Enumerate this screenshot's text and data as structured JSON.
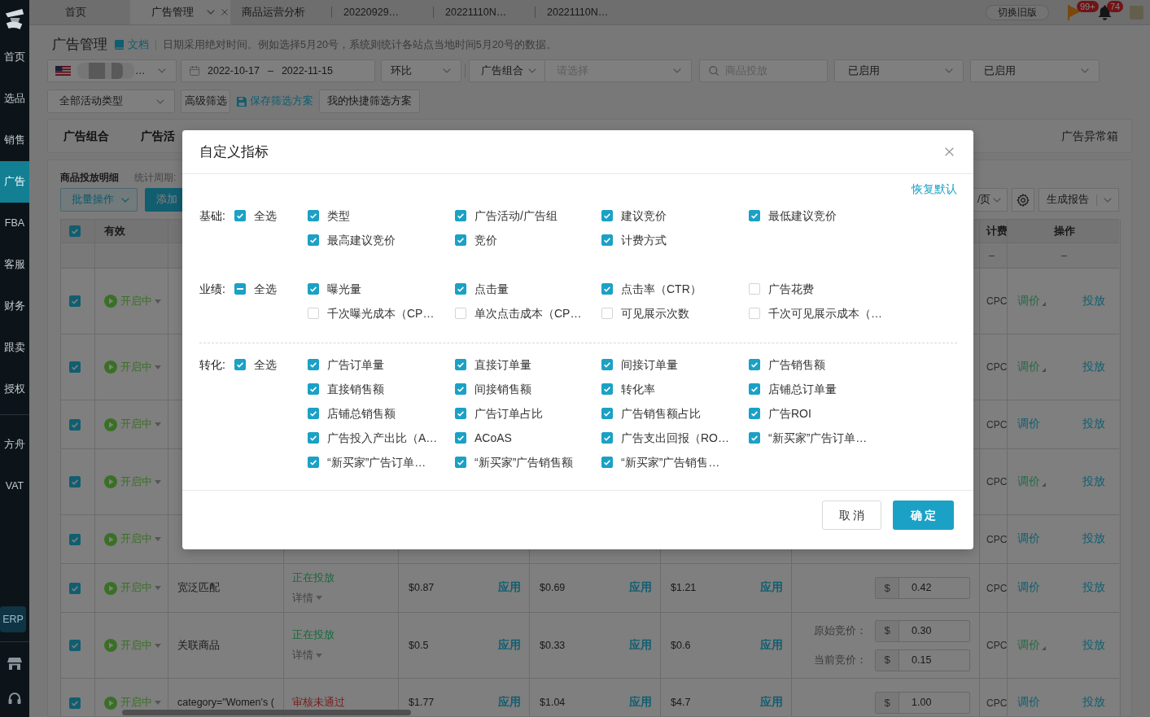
{
  "sidebar": {
    "items": [
      {
        "label": "首页",
        "selected": false
      },
      {
        "label": "选品",
        "selected": false
      },
      {
        "label": "销售",
        "selected": false
      },
      {
        "label": "广告",
        "selected": true
      },
      {
        "label": "FBA",
        "selected": false
      },
      {
        "label": "客服",
        "selected": false
      },
      {
        "label": "财务",
        "selected": false
      },
      {
        "label": "跟卖",
        "selected": false
      },
      {
        "label": "授权",
        "selected": false
      }
    ],
    "extra_items": [
      {
        "label": "方舟",
        "selected": false
      },
      {
        "label": "VAT",
        "selected": false
      }
    ],
    "erp_button": "ERP"
  },
  "tabs": [
    {
      "label": "首页",
      "selected": false
    },
    {
      "label": "广告管理",
      "selected": true
    },
    {
      "label": "商品运营分析",
      "selected": false
    },
    {
      "label": "20220929…",
      "selected": false
    },
    {
      "label": "20221110N…",
      "selected": false
    },
    {
      "label": "20221110N…",
      "selected": false
    }
  ],
  "topbar": {
    "switch_button": "切换旧版",
    "flag_badge": "99+",
    "bell_badge": "74"
  },
  "header": {
    "title": "广告管理",
    "doc_link": "文档",
    "note": "日期采用绝对时间。例如选择5月20号，系统则统计各站点当地时间5月20号的数据。"
  },
  "filters": {
    "store_value": "…",
    "date_start": "2022-10-17",
    "date_separator": "–",
    "date_end": "2022-11-15",
    "compare": "环比",
    "group_type": "广告组合",
    "group_placeholder": "请选择",
    "search_placeholder": "商品投放",
    "state_filters": [
      "已启用",
      "已启用"
    ],
    "campaign_type": "全部活动类型",
    "advanced_button": "高级筛选",
    "save_link": "保存筛选方案",
    "presets_button": "我的快捷筛选方案"
  },
  "level_tabs": {
    "items": [
      {
        "label": "广告组合",
        "selected": false
      },
      {
        "label": "广告活",
        "selected": false
      }
    ],
    "exception_box": "广告异常箱"
  },
  "detail": {
    "title": "商品投放明细",
    "period_label": "统计周期:",
    "batch_button": "批量操作",
    "add_button": "添加",
    "page_size": "/页",
    "report_button": "生成报告"
  },
  "table": {
    "header_checked": true,
    "headings": {
      "status": "有效",
      "billing": "计费",
      "actions": "操作"
    },
    "summary": {
      "billing": "–",
      "actions": "–"
    },
    "rows": [
      {
        "checked": true,
        "state": "开启中",
        "billing": "CPC",
        "adjust": "调价",
        "adjusted": true,
        "launch": "投放"
      },
      {
        "checked": true,
        "state": "开启中",
        "billing": "CPC",
        "adjust": "调价",
        "adjusted": true,
        "launch": "投放"
      },
      {
        "checked": true,
        "state": "开启中",
        "billing": "CPC",
        "adjust": "调价",
        "adjusted": false,
        "launch": "投放"
      },
      {
        "checked": true,
        "state": "开启中",
        "billing": "CPC",
        "adjust": "调价",
        "adjusted": true,
        "launch": "投放"
      },
      {
        "checked": true,
        "state": "开启中",
        "billing": "CPC",
        "adjust": "调价",
        "adjusted": false,
        "launch": "投放"
      },
      {
        "checked": true,
        "state": "开启中",
        "target": "宽泛匹配",
        "serving": {
          "text": "正在投放",
          "kind": "active"
        },
        "details": "详情",
        "suggested": [
          {
            "price": "$0.87",
            "apply": "应用"
          },
          {
            "price": "$0.69",
            "apply": "应用"
          },
          {
            "price": "$1.21",
            "apply": "应用"
          }
        ],
        "bids": [
          {
            "currency": "$",
            "value": "0.42"
          }
        ],
        "billing": "CPC",
        "adjust": "调价",
        "adjusted": false,
        "launch": "投放"
      },
      {
        "checked": true,
        "state": "开启中",
        "target": "关联商品",
        "serving": {
          "text": "正在投放",
          "kind": "active"
        },
        "details": "详情",
        "suggested": [
          {
            "price": "$0.5",
            "apply": "应用"
          },
          {
            "price": "$0.33",
            "apply": "应用"
          },
          {
            "price": "$0.6",
            "apply": "应用"
          }
        ],
        "bids": [
          {
            "label": "原始竞价：",
            "currency": "$",
            "value": "0.30"
          },
          {
            "label": "当前竞价：",
            "currency": "$",
            "value": "0.15"
          }
        ],
        "billing": "CPC",
        "adjust": "调价",
        "adjusted": true,
        "launch": "投放"
      },
      {
        "checked": true,
        "state": "开启中",
        "target": "category=\"Women's (",
        "serving": {
          "text": "审核未通过",
          "kind": "rejected"
        },
        "suggested": [
          {
            "price": "$1.77",
            "apply": "应用"
          },
          {
            "price": "$1.04",
            "apply": "应用"
          },
          {
            "price": "$4.7",
            "apply": "应用"
          }
        ],
        "bids": [
          {
            "currency": "$",
            "value": "1.00"
          }
        ],
        "billing": "CPC",
        "adjust": "调价",
        "adjusted": false,
        "launch": "投放"
      }
    ]
  },
  "dialog": {
    "title": "自定义指标",
    "reset_link": "恢复默认",
    "groups": [
      {
        "label": "基础:",
        "divider_above": false,
        "select_all": {
          "label": "全选",
          "checked": true,
          "indeterminate": false
        },
        "items": [
          {
            "label": "类型",
            "checked": true
          },
          {
            "label": "广告活动/广告组",
            "checked": true
          },
          {
            "label": "建议竞价",
            "checked": true
          },
          {
            "label": "最低建议竞价",
            "checked": true
          },
          {
            "label": "最高建议竞价",
            "checked": true
          },
          {
            "label": "竞价",
            "checked": true
          },
          {
            "label": "计费方式",
            "checked": true
          }
        ]
      },
      {
        "label": "业绩:",
        "divider_above": false,
        "select_all": {
          "label": "全选",
          "checked": false,
          "indeterminate": true
        },
        "items": [
          {
            "label": "曝光量",
            "checked": true
          },
          {
            "label": "点击量",
            "checked": true
          },
          {
            "label": "点击率（CTR）",
            "checked": true
          },
          {
            "label": "广告花费",
            "checked": false
          },
          {
            "label": "千次曝光成本（CP…",
            "checked": false
          },
          {
            "label": "单次点击成本（CP…",
            "checked": false
          },
          {
            "label": "可见展示次数",
            "checked": false
          },
          {
            "label": "千次可见展示成本（…",
            "checked": false
          }
        ]
      },
      {
        "label": "转化:",
        "divider_above": true,
        "select_all": {
          "label": "全选",
          "checked": true,
          "indeterminate": false
        },
        "items": [
          {
            "label": "广告订单量",
            "checked": true
          },
          {
            "label": "直接订单量",
            "checked": true
          },
          {
            "label": "间接订单量",
            "checked": true
          },
          {
            "label": "广告销售额",
            "checked": true
          },
          {
            "label": "直接销售额",
            "checked": true
          },
          {
            "label": "间接销售额",
            "checked": true
          },
          {
            "label": "转化率",
            "checked": true
          },
          {
            "label": "店铺总订单量",
            "checked": true
          },
          {
            "label": "店铺总销售额",
            "checked": true
          },
          {
            "label": "广告订单占比",
            "checked": true
          },
          {
            "label": "广告销售额占比",
            "checked": true
          },
          {
            "label": "广告ROI",
            "checked": true
          },
          {
            "label": "广告投入产出比（A…",
            "checked": true
          },
          {
            "label": "ACoAS",
            "checked": true
          },
          {
            "label": "广告支出回报（RO…",
            "checked": true
          },
          {
            "label": "“新买家”广告订单…",
            "checked": true
          },
          {
            "label": "“新买家”广告订单…",
            "checked": true
          },
          {
            "label": "“新买家”广告销售额",
            "checked": true
          },
          {
            "label": "“新买家”广告销售…",
            "checked": true
          }
        ]
      }
    ],
    "cancel_button": "取 消",
    "ok_button": "确 定"
  }
}
